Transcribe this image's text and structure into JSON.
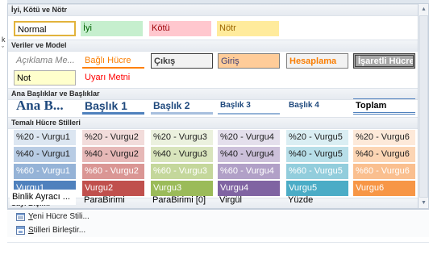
{
  "sections": {
    "good_bad": "İyi, Kötü ve Nötr",
    "data_model": "Veriler ve Model",
    "titles": "Ana Başlıklar ve Başlıklar",
    "themed": "Temalı Hücre Stilleri",
    "number_format": "Sayı Biçimi"
  },
  "good_bad": {
    "normal": "Normal",
    "good": "İyi",
    "bad": "Kötü",
    "neutral": "Nötr"
  },
  "data_model": {
    "explanatory": "Açıklama Me...",
    "linked_cell": "Bağlı Hücre",
    "output": "Çıkış",
    "input": "Giriş",
    "calculation": "Hesaplama",
    "check_cell": "İşaretli Hücre",
    "note": "Not",
    "warning_text": "Uyarı Metni"
  },
  "titles": {
    "title": "Ana B...",
    "h1": "Başlık 1",
    "h2": "Başlık 2",
    "h3": "Başlık 3",
    "h4": "Başlık 4",
    "total": "Toplam"
  },
  "themed": {
    "row20": [
      "%20 - Vurgu1",
      "%20 - Vurgu2",
      "%20 - Vurgu3",
      "%20 - Vurgu4",
      "%20 - Vurgu5",
      "%20 - Vurgu6"
    ],
    "row40": [
      "%40 - Vurgu1",
      "%40 - Vurgu2",
      "%40 - Vurgu3",
      "%40 - Vurgu4",
      "%40 - Vurgu5",
      "%40 - Vurgu6"
    ],
    "row60": [
      "%60 - Vurgu1",
      "%60 - Vurgu2",
      "%60 - Vurgu3",
      "%60 - Vurgu4",
      "%60 - Vurgu5",
      "%60 - Vurgu6"
    ],
    "accent": [
      "Vurgu1",
      "Vurgu2",
      "Vurgu3",
      "Vurgu4",
      "Vurgu5",
      "Vurgu6"
    ]
  },
  "number_format": {
    "comma": "Binlik Ayracı ...",
    "currency": "ParaBirimi",
    "currency0": "ParaBirimi [0]",
    "comma0": "Virgül",
    "percent": "Yüzde"
  },
  "menu": {
    "new_style_first": "Y",
    "new_style_rest": "eni Hücre Stili...",
    "merge_first": "S",
    "merge_rest": "tilleri Birleştir..."
  },
  "left_fragment": {
    "a": "k",
    "b": "ˇ"
  },
  "colors": {
    "accent1": "#4f81bd",
    "accent2": "#c0504d",
    "accent3": "#9bbb59",
    "accent4": "#8064a2",
    "accent5": "#4bacc6",
    "accent6": "#f79646"
  },
  "icons": {
    "new_style": "new-cell-style-icon",
    "merge": "merge-styles-icon",
    "scroll_up": "scroll-up-arrow",
    "scroll_down": "scroll-down-arrow"
  }
}
